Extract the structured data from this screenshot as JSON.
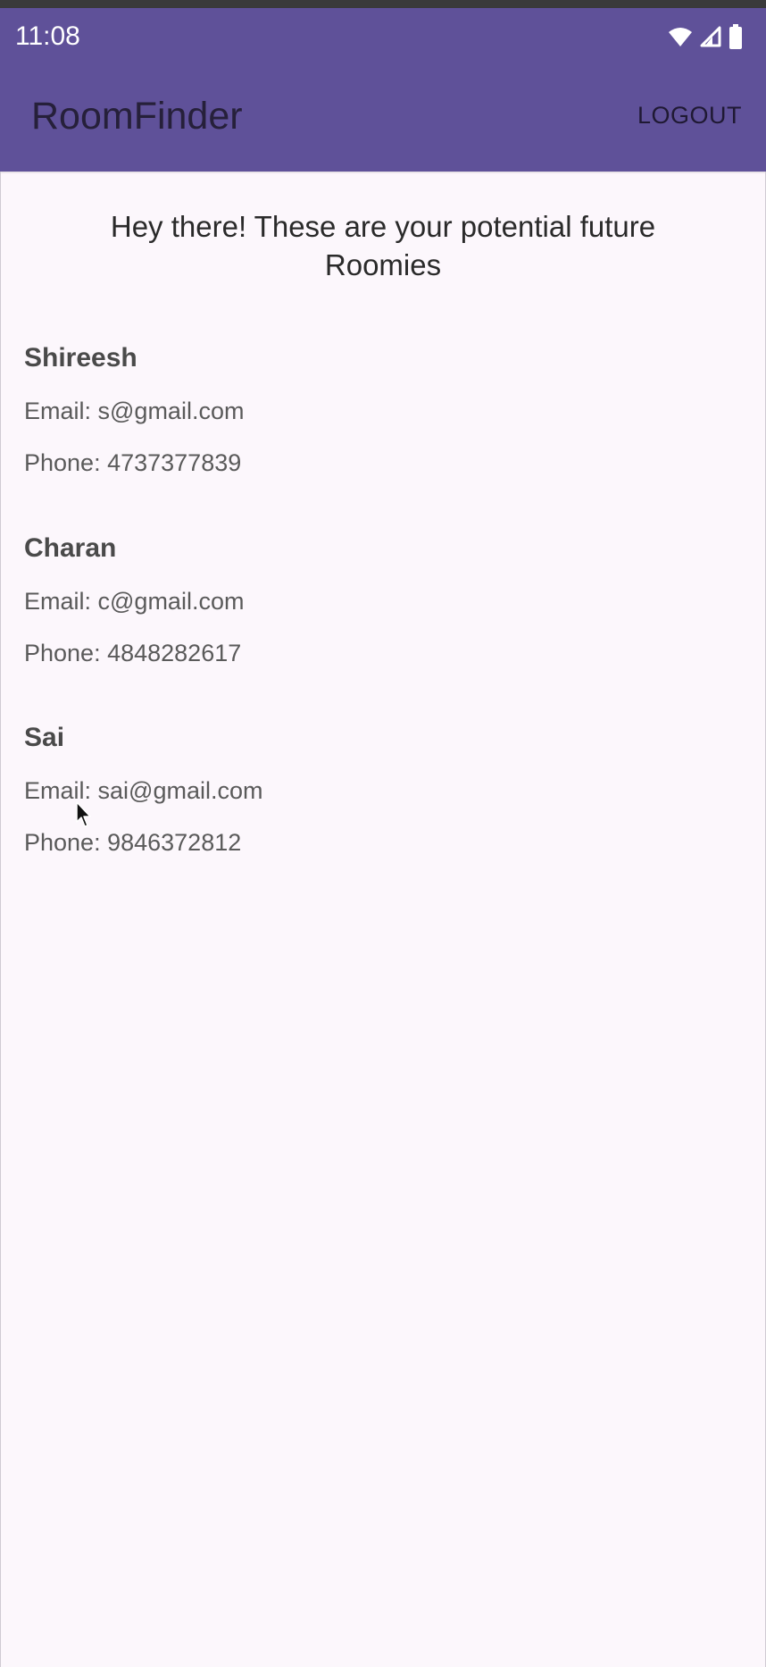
{
  "status_bar": {
    "time": "11:08",
    "icons": [
      "wifi-icon",
      "signal-icon",
      "battery-icon"
    ]
  },
  "app_bar": {
    "title": "RoomFinder",
    "logout_label": "LOGOUT"
  },
  "main": {
    "intro_line1": "Hey there! These are your potential future",
    "intro_line2": "Roomies",
    "roommates": [
      {
        "name": "Shireesh",
        "email": "Email: s@gmail.com",
        "phone": "Phone: 4737377839"
      },
      {
        "name": "Charan",
        "email": "Email: c@gmail.com",
        "phone": "Phone: 4848282617"
      },
      {
        "name": "Sai",
        "email": "Email: sai@gmail.com",
        "phone": "Phone: 9846372812"
      }
    ]
  },
  "colors": {
    "app_bar": "#5f5199",
    "background": "#fcf7fc"
  }
}
